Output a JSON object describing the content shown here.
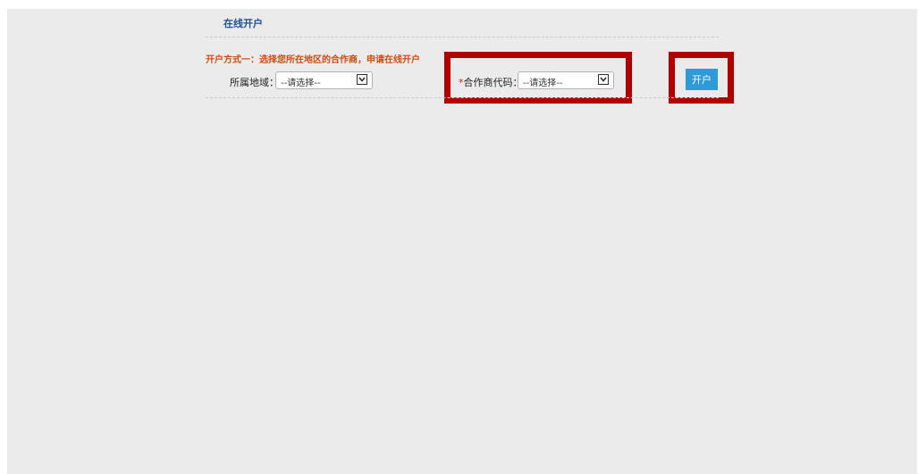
{
  "header": {
    "title": "在线开户"
  },
  "method": {
    "text": "开户方式一：选择您所在地区的合作商，申请在线开户"
  },
  "region": {
    "label": "所属地域：",
    "select_value": "--请选择--"
  },
  "partner": {
    "required_mark": "*",
    "label": "合作商代码：",
    "select_value": "--请选择--"
  },
  "actions": {
    "open_account_label": "开户"
  },
  "colors": {
    "highlight": "#b00000",
    "button": "#2e9bd8",
    "method_text": "#d04b13",
    "title": "#1f4f8f"
  },
  "icons": {
    "select_arrow": "chevron-down-icon"
  }
}
